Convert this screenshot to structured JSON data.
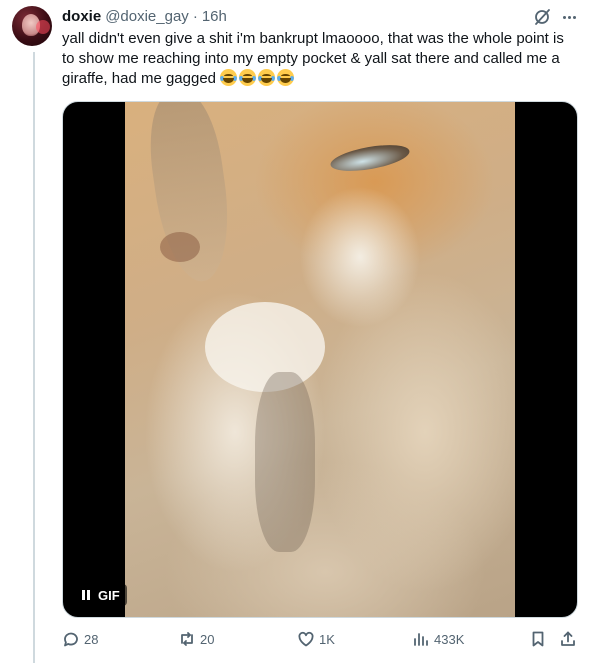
{
  "tweet": {
    "author_name": "doxie",
    "handle": "@doxie_gay",
    "separator": "·",
    "time": "16h",
    "text": "yall didn't even give a shit i'm bankrupt lmaoooo, that was the whole point is to show me reaching into my empty pocket & yall sat there and called me a giraffe, had me gagged",
    "emojis": [
      "face-with-tears-of-joy",
      "face-with-tears-of-joy",
      "face-with-tears-of-joy",
      "face-with-tears-of-joy"
    ]
  },
  "media": {
    "badge_label": "GIF",
    "playback_icon": "pause-icon"
  },
  "actions": {
    "replies": "28",
    "reposts": "20",
    "likes": "1K",
    "views": "433K"
  },
  "icons": {
    "grok": "grok-icon",
    "more": "more-icon",
    "reply": "reply-icon",
    "repost": "repost-icon",
    "like": "heart-icon",
    "views": "analytics-icon",
    "bookmark": "bookmark-icon",
    "share": "share-icon"
  },
  "colors": {
    "text": "#0f1419",
    "secondary": "#536471",
    "border": "#cfd9de"
  }
}
